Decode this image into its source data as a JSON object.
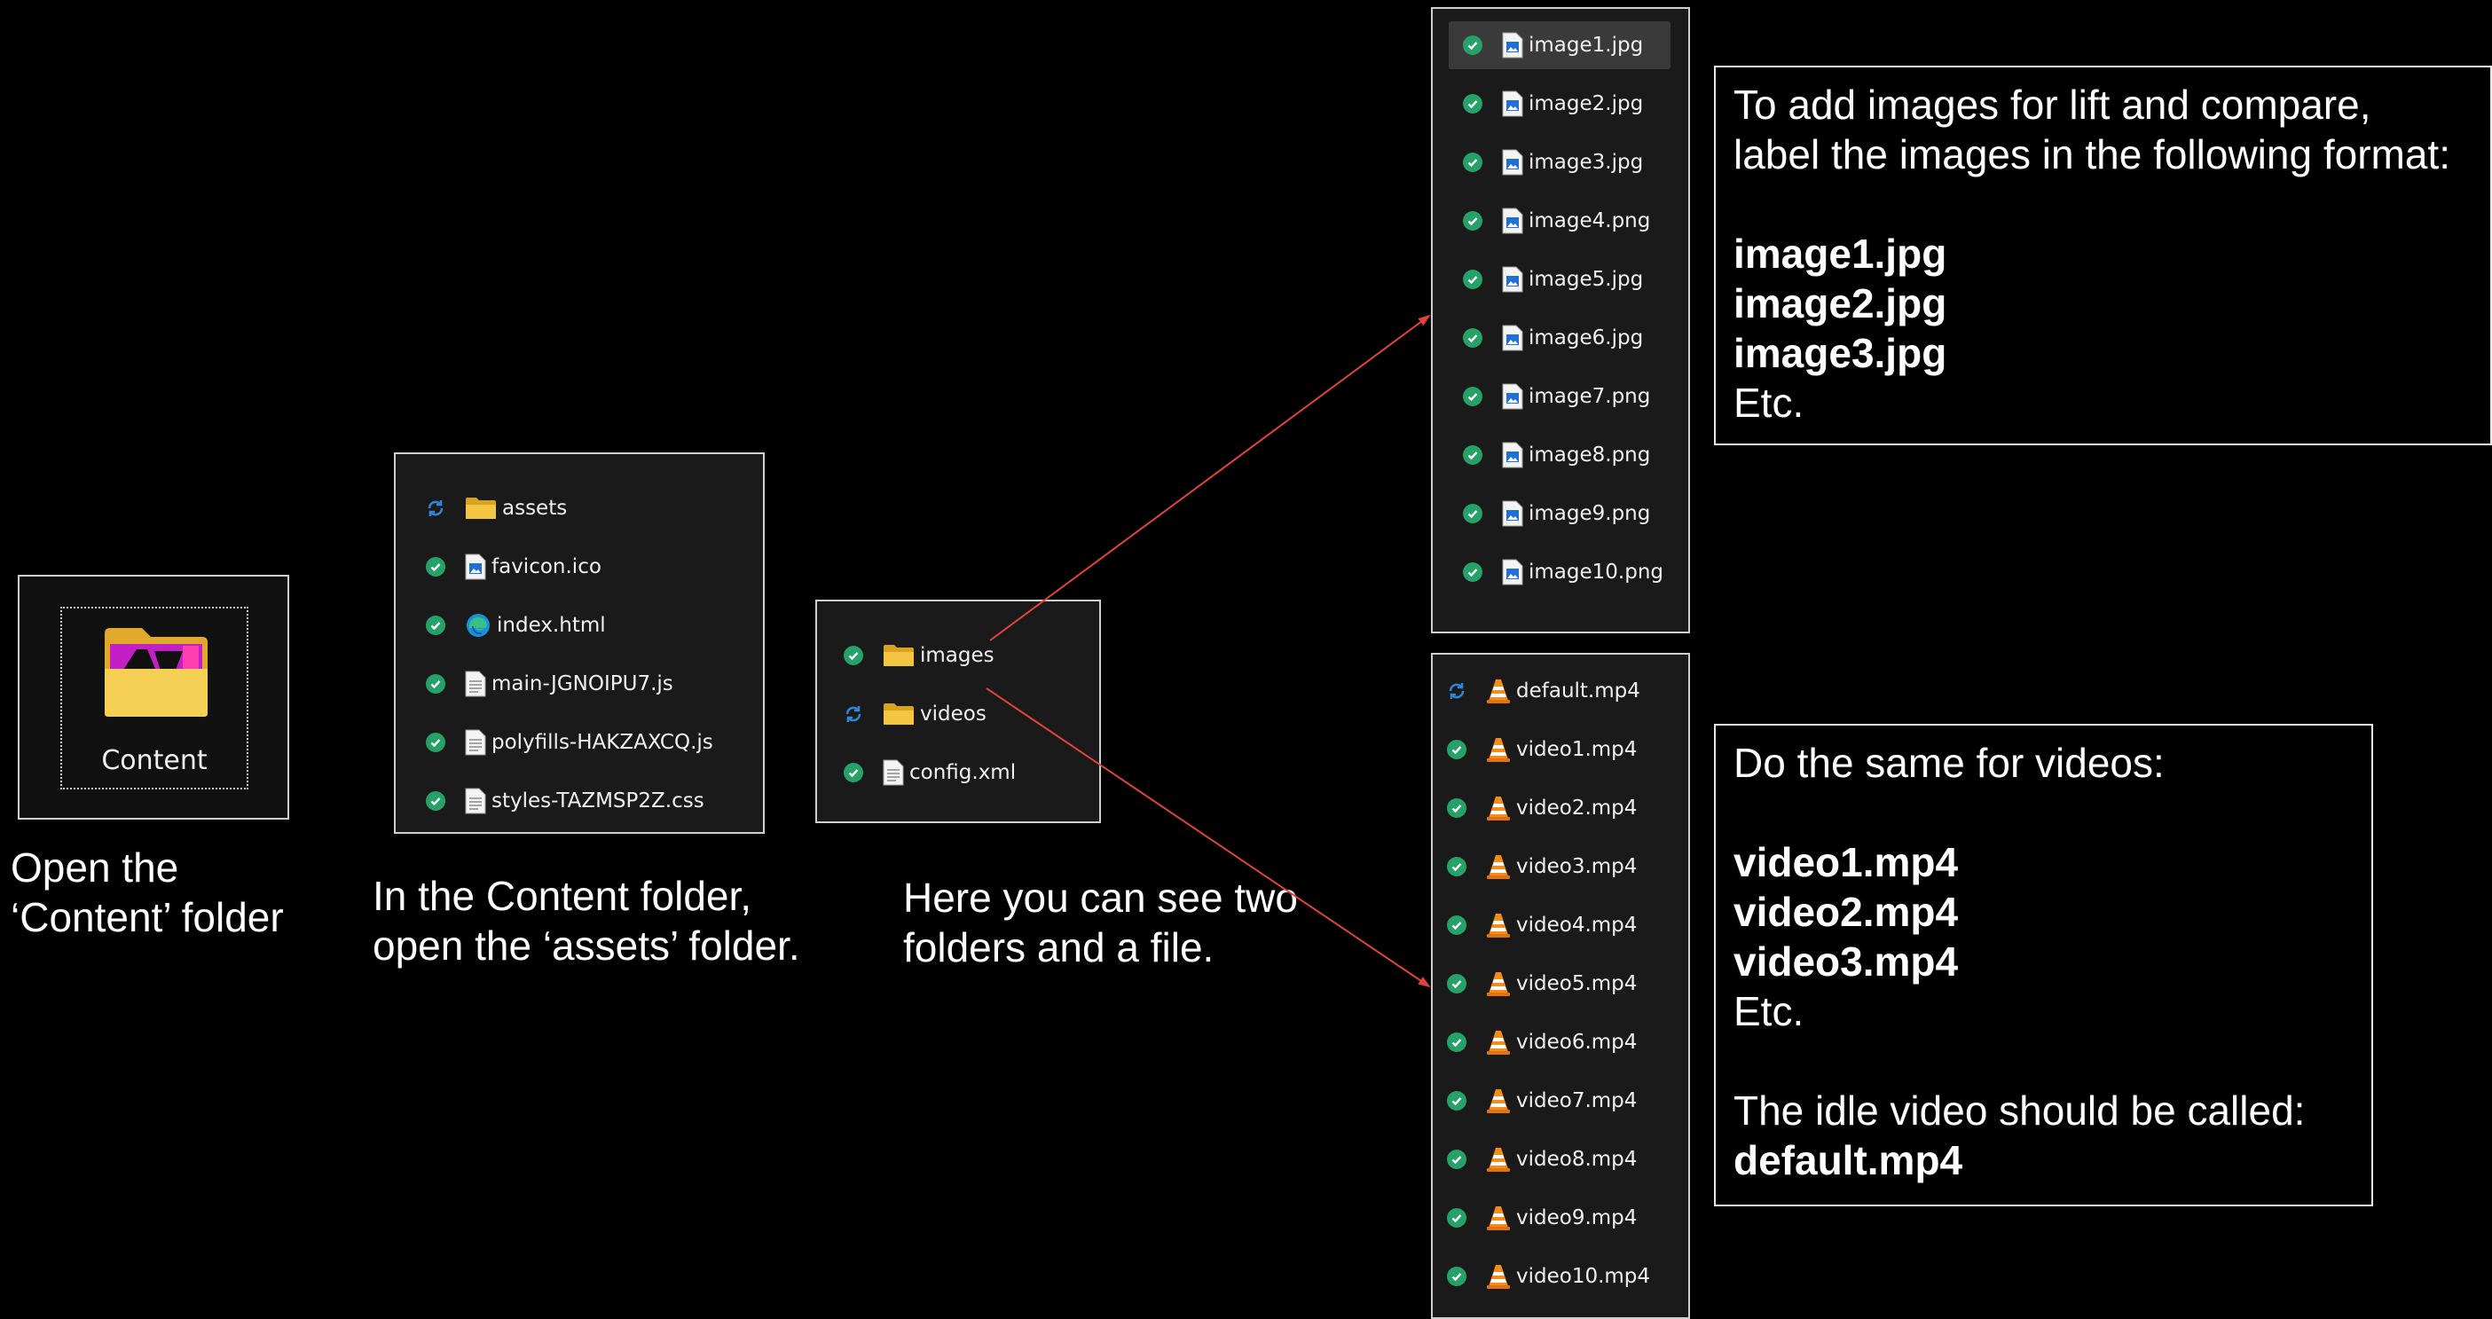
{
  "content_tile": {
    "label": "Content",
    "caption_lines": [
      "Open the",
      "‘Content’ folder"
    ]
  },
  "assets_panel": {
    "items": [
      {
        "name": "assets",
        "type": "folder",
        "status": "syncing"
      },
      {
        "name": "favicon.ico",
        "type": "image",
        "status": "synced"
      },
      {
        "name": "index.html",
        "type": "html",
        "status": "synced"
      },
      {
        "name": "main-JGNOIPU7.js",
        "type": "doc",
        "status": "synced"
      },
      {
        "name": "polyfills-HAKZAXCQ.js",
        "type": "doc",
        "status": "synced"
      },
      {
        "name": "styles-TAZMSP2Z.css",
        "type": "doc",
        "status": "synced"
      }
    ],
    "caption_lines": [
      "In the Content folder,",
      "open the ‘assets’ folder."
    ]
  },
  "assets_contents_panel": {
    "items": [
      {
        "name": "images",
        "type": "folder",
        "status": "synced"
      },
      {
        "name": "videos",
        "type": "folder",
        "status": "syncing"
      },
      {
        "name": "config.xml",
        "type": "doc",
        "status": "synced"
      }
    ],
    "caption_lines": [
      "Here you can see two",
      "folders and a file."
    ]
  },
  "images_panel": {
    "items": [
      {
        "name": "image1.jpg",
        "status": "synced",
        "selected": true
      },
      {
        "name": "image2.jpg",
        "status": "synced"
      },
      {
        "name": "image3.jpg",
        "status": "synced"
      },
      {
        "name": "image4.png",
        "status": "synced"
      },
      {
        "name": "image5.jpg",
        "status": "synced"
      },
      {
        "name": "image6.jpg",
        "status": "synced"
      },
      {
        "name": "image7.png",
        "status": "synced"
      },
      {
        "name": "image8.png",
        "status": "synced"
      },
      {
        "name": "image9.png",
        "status": "synced"
      },
      {
        "name": "image10.png",
        "status": "synced"
      }
    ]
  },
  "videos_panel": {
    "items": [
      {
        "name": "default.mp4",
        "status": "syncing"
      },
      {
        "name": "video1.mp4",
        "status": "synced"
      },
      {
        "name": "video2.mp4",
        "status": "synced"
      },
      {
        "name": "video3.mp4",
        "status": "synced"
      },
      {
        "name": "video4.mp4",
        "status": "synced"
      },
      {
        "name": "video5.mp4",
        "status": "synced"
      },
      {
        "name": "video6.mp4",
        "status": "synced"
      },
      {
        "name": "video7.mp4",
        "status": "synced"
      },
      {
        "name": "video8.mp4",
        "status": "synced"
      },
      {
        "name": "video9.mp4",
        "status": "synced"
      },
      {
        "name": "video10.mp4",
        "status": "synced"
      }
    ]
  },
  "images_note": {
    "line1": "To add images for lift and compare,",
    "line2": "label the images in the following format:",
    "examples": [
      "image1.jpg",
      "image2.jpg",
      "image3.jpg"
    ],
    "etc": "Etc."
  },
  "videos_note": {
    "line1": "Do the same for videos:",
    "examples": [
      "video1.mp4",
      "video2.mp4",
      "video3.mp4"
    ],
    "etc": "Etc.",
    "idle_line": "The idle video should be called:",
    "idle_name": "default.mp4"
  },
  "colors": {
    "arrow": "#e0443a",
    "synced": "#26a269",
    "syncing": "#2f86d9",
    "folder": "#f4c542"
  }
}
